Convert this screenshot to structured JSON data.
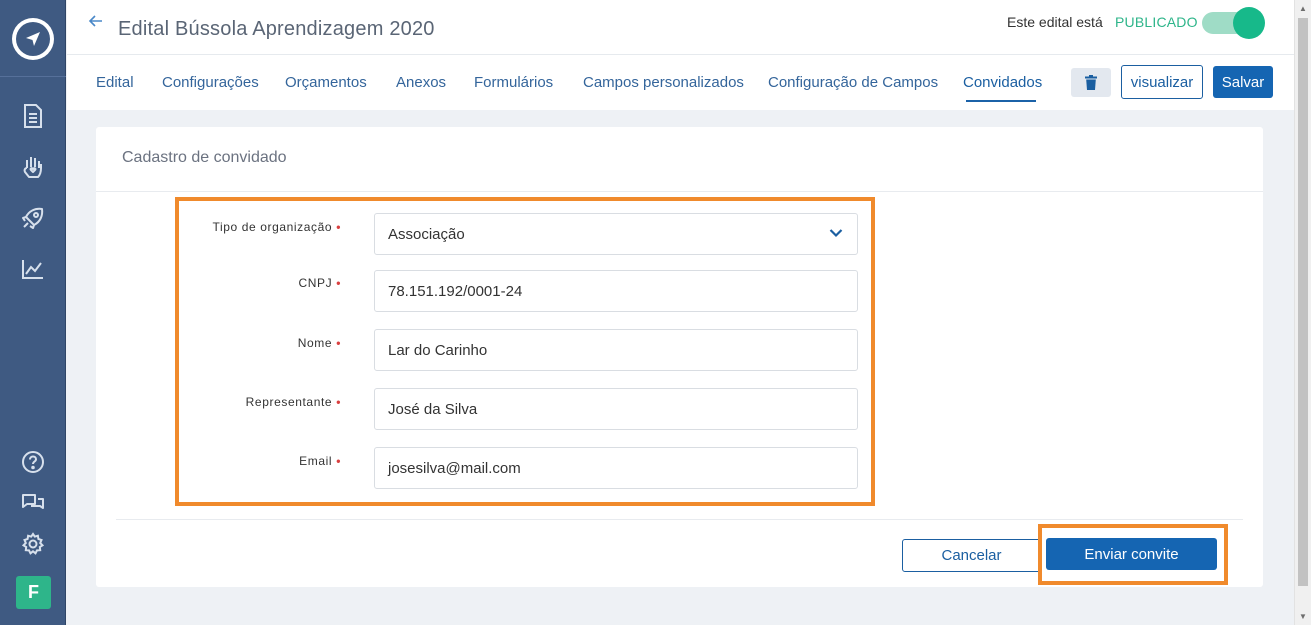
{
  "header": {
    "title": "Edital Bússola Aprendizagem 2020",
    "status_prefix": "Este edital está",
    "status_value": "PUBLICADO",
    "view_label": "visualizar",
    "save_label": "Salvar"
  },
  "tabs": [
    {
      "label": "Edital"
    },
    {
      "label": "Configurações"
    },
    {
      "label": "Orçamentos"
    },
    {
      "label": "Anexos"
    },
    {
      "label": "Formulários"
    },
    {
      "label": "Campos personalizados"
    },
    {
      "label": "Configuração de Campos"
    },
    {
      "label": "Convidados",
      "active": true
    }
  ],
  "sidebar": {
    "avatar_initial": "F",
    "icons": [
      "logo-compass-icon",
      "document-icon",
      "hand-heart-icon",
      "rocket-icon",
      "chart-icon",
      "help-icon",
      "chat-icon",
      "settings-icon"
    ]
  },
  "card": {
    "title": "Cadastro de convidado",
    "fields": [
      {
        "label": "Tipo de organização",
        "value": "Associação",
        "type": "select"
      },
      {
        "label": "CNPJ",
        "value": "78.151.192/0001-24"
      },
      {
        "label": "Nome",
        "value": "Lar do Carinho"
      },
      {
        "label": "Representante",
        "value": "José da Silva"
      },
      {
        "label": "Email",
        "value": "josesilva@mail.com"
      }
    ],
    "cancel_label": "Cancelar",
    "send_label": "Enviar convite"
  },
  "colors": {
    "sidebar": "#3f5a82",
    "primary": "#1565b2",
    "success": "#2eb58a",
    "highlight": "#f08a2c"
  }
}
